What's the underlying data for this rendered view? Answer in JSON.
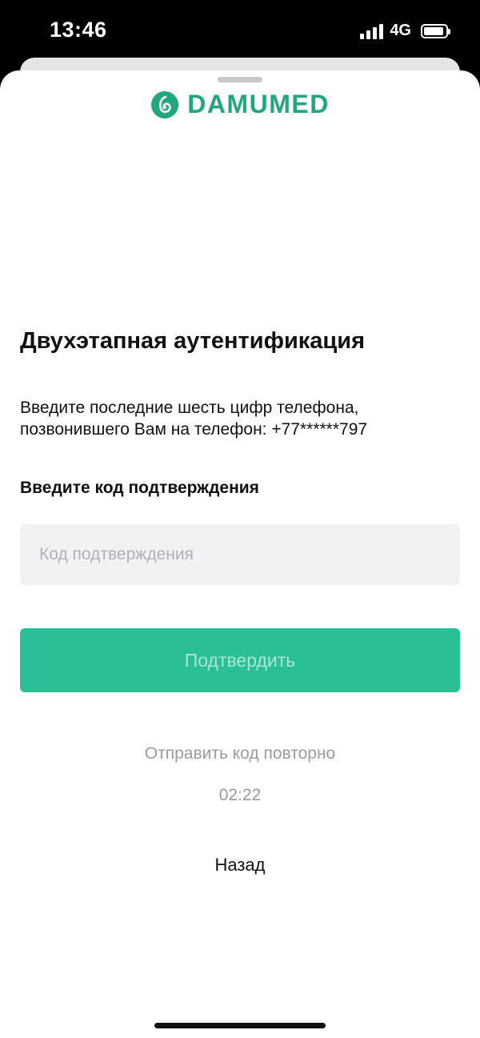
{
  "status_bar": {
    "time": "13:46",
    "network": "4G"
  },
  "brand": {
    "name": "DAMUMED",
    "color": "#21a67d",
    "logo_icon": "damumed-logo-icon"
  },
  "auth": {
    "title": "Двухэтапная аутентификация",
    "description_line1": "Введите последние шесть цифр телефона,",
    "description_line2": "позвонившего Вам на телефон: +77******797",
    "field_label": "Введите код подтверждения",
    "code_input": {
      "value": "",
      "placeholder": "Код подтверждения"
    },
    "confirm_label": "Подтвердить",
    "resend_label": "Отправить код повторно",
    "timer": "02:22",
    "back_label": "Назад"
  },
  "colors": {
    "accent": "#2bbf97",
    "accent_text_disabled": "#a9e6d3",
    "muted_text": "#9a9a9f"
  }
}
